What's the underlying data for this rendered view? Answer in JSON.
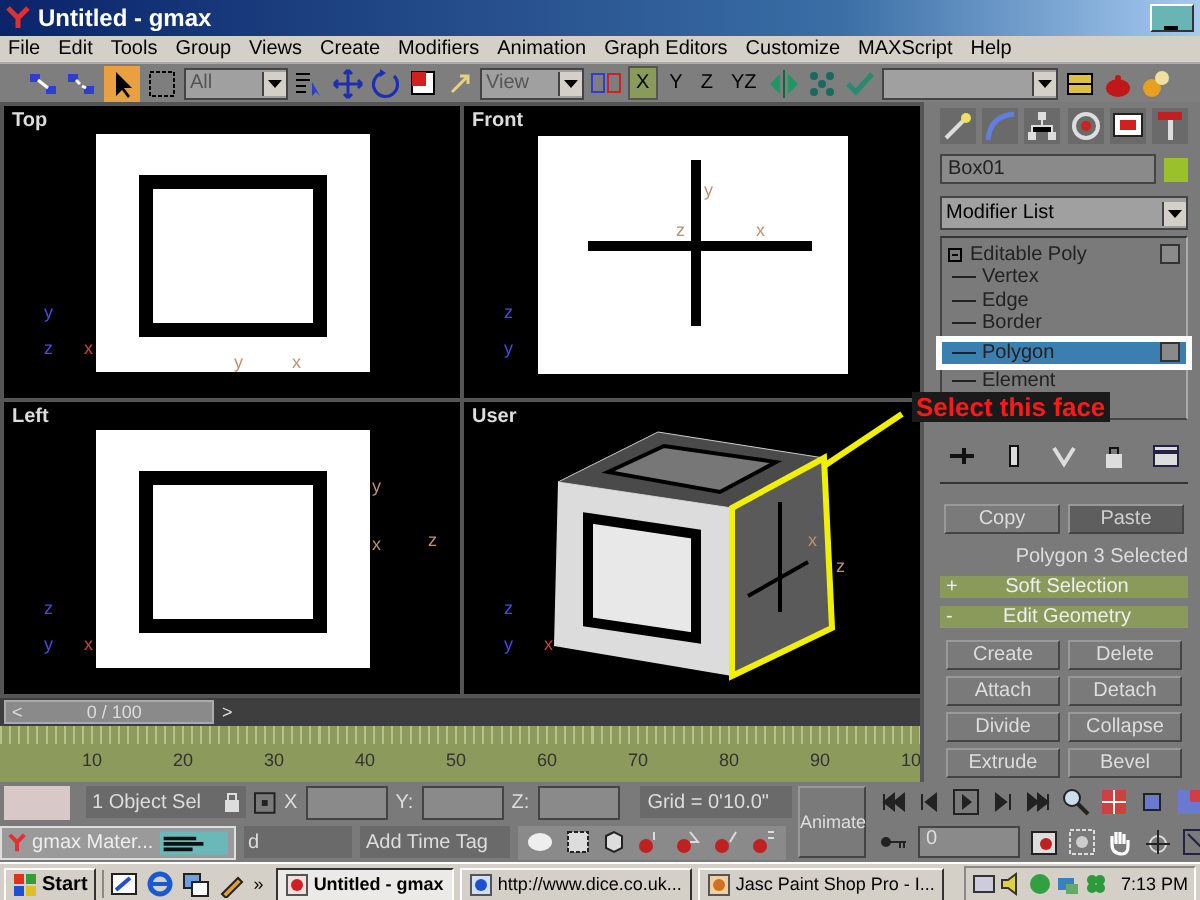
{
  "window": {
    "title": "Untitled - gmax"
  },
  "menu": [
    "File",
    "Edit",
    "Tools",
    "Group",
    "Views",
    "Create",
    "Modifiers",
    "Animation",
    "Graph Editors",
    "Customize",
    "MAXScript",
    "Help"
  ],
  "toolbar": {
    "select_tool": {
      "selected": true
    },
    "selection_filter": "All",
    "reference_coord": "View",
    "axis_buttons": [
      {
        "label": "X",
        "selected": true
      },
      {
        "label": "Y",
        "selected": false
      },
      {
        "label": "Z",
        "selected": false
      },
      {
        "label": "YZ",
        "selected": false
      }
    ]
  },
  "viewports": [
    {
      "label": "Top",
      "kind": "top",
      "axis_labels": [
        "y",
        "z",
        "x"
      ],
      "gizmo_labels": [
        "y",
        "x"
      ]
    },
    {
      "label": "Front",
      "kind": "front",
      "axis_labels": [
        "z",
        "y"
      ],
      "gizmo_labels": [
        "y",
        "z",
        "x"
      ]
    },
    {
      "label": "Left",
      "kind": "left",
      "axis_labels": [
        "z",
        "y",
        "x"
      ],
      "gizmo_labels": [
        "y",
        "x",
        "z"
      ]
    },
    {
      "label": "User",
      "kind": "user",
      "axis_labels": [
        "z",
        "y",
        "x"
      ],
      "gizmo_labels": [
        "x",
        "z"
      ]
    }
  ],
  "annotation": {
    "text": "Select this face"
  },
  "command_panel": {
    "object_name": "Box01",
    "modifier_list": "Modifier List",
    "stack": [
      {
        "label": "Editable Poly",
        "expanded": true,
        "children": [
          {
            "label": "Vertex",
            "selected": false
          },
          {
            "label": "Edge",
            "selected": false
          },
          {
            "label": "Border",
            "selected": false
          },
          {
            "label": "Polygon",
            "selected": true
          },
          {
            "label": "Element",
            "selected": false
          }
        ]
      }
    ],
    "clipboard": [
      {
        "label": "Copy",
        "disabled": false
      },
      {
        "label": "Paste",
        "disabled": true
      }
    ],
    "selection_status": "Polygon 3 Selected",
    "rollouts": [
      {
        "sign": "+",
        "title": "Soft Selection"
      },
      {
        "sign": "-",
        "title": "Edit Geometry"
      }
    ],
    "edit_buttons": [
      "Create",
      "Delete",
      "Attach",
      "Detach",
      "Divide",
      "Collapse",
      "Extrude",
      "Bevel"
    ]
  },
  "time_slider": {
    "prev": "<",
    "label": "0 / 100",
    "next": ">"
  },
  "track": {
    "ticks": [
      "10",
      "20",
      "30",
      "40",
      "50",
      "60",
      "70",
      "80",
      "90",
      "10"
    ]
  },
  "status": {
    "selection": "1 Object Sel",
    "x_label": "X",
    "y_label": "Y:",
    "z_label": "Z:",
    "grid": "Grid = 0'10.0\"",
    "animate": "Animate",
    "prompt": "d",
    "time_tag": "Add Time Tag",
    "frame": "0"
  },
  "floating_item": {
    "label": "gmax Mater..."
  },
  "taskbar": {
    "start": "Start",
    "more": "»",
    "tasks": [
      {
        "label": "Untitled - gmax",
        "selected": true
      },
      {
        "label": "http://www.dice.co.uk...",
        "selected": false
      },
      {
        "label": "Jasc Paint Shop Pro - I...",
        "selected": false
      }
    ],
    "clock": "7:13 PM"
  }
}
